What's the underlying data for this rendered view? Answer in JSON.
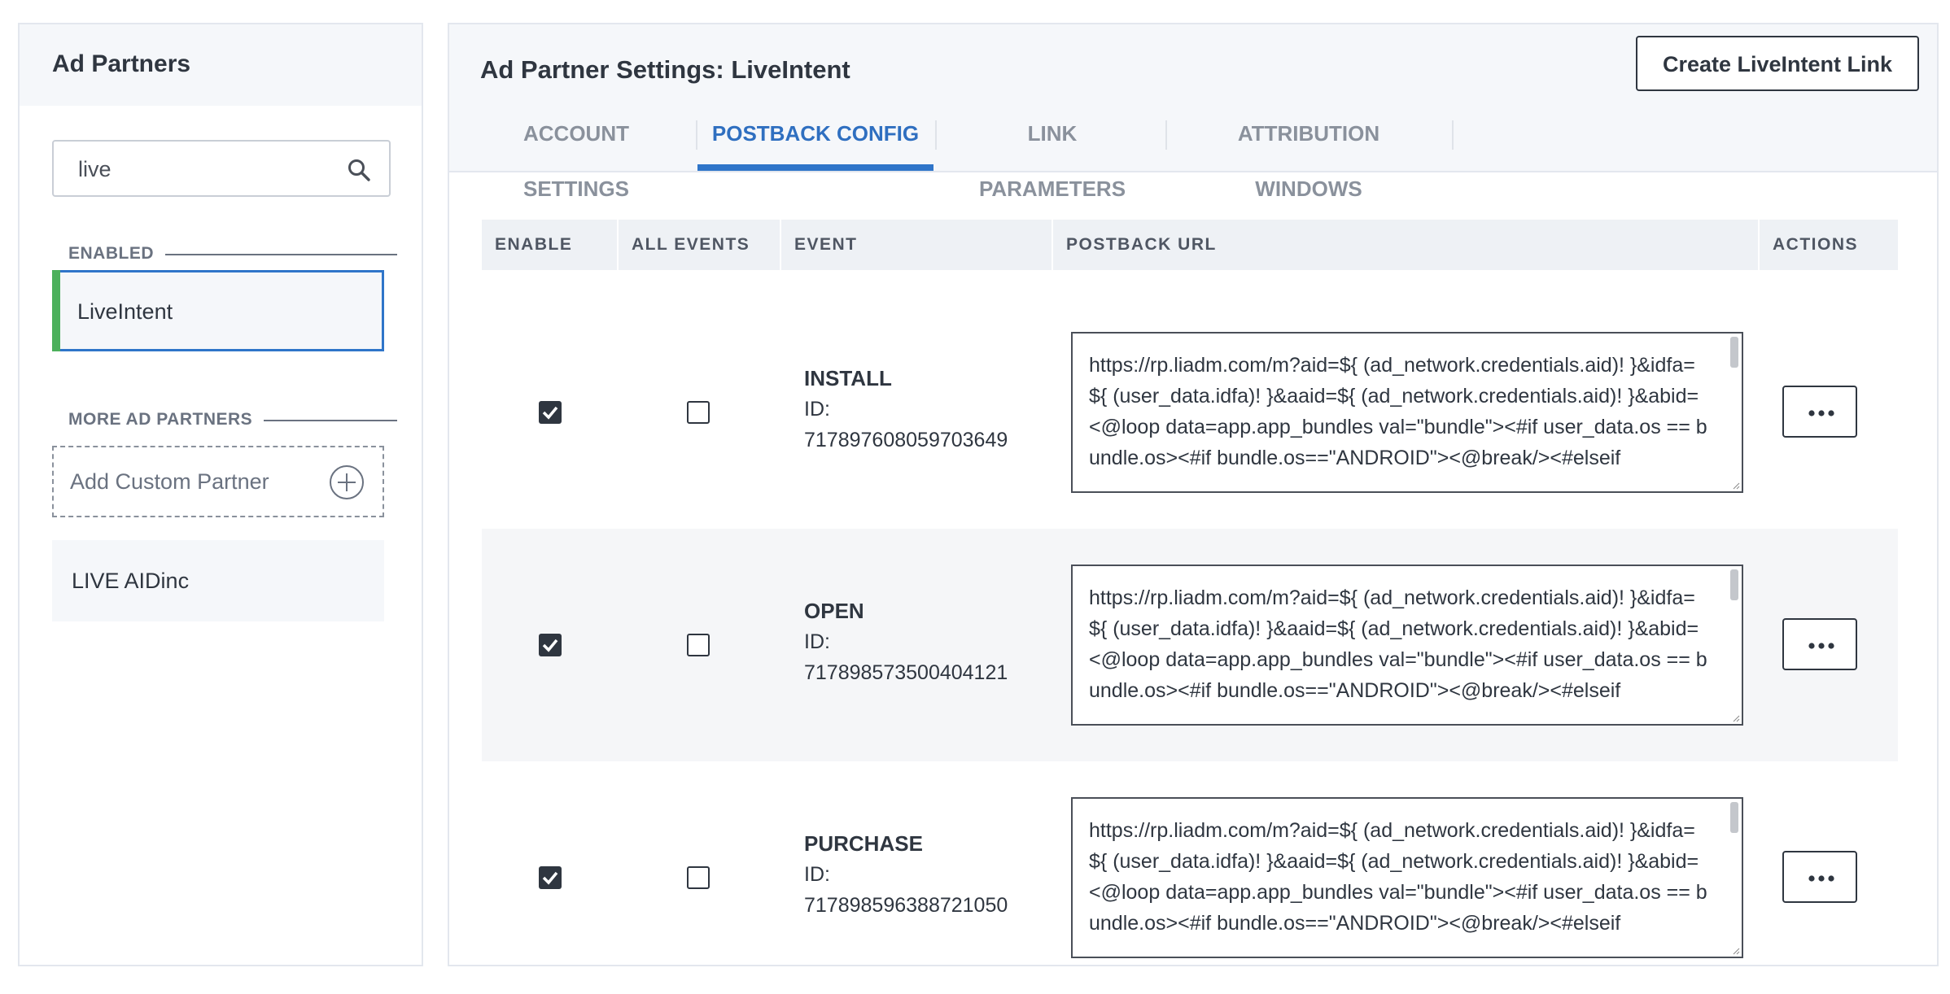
{
  "sidebar": {
    "title": "Ad Partners",
    "search": {
      "value": "live",
      "placeholder": ""
    },
    "enabled_label": "ENABLED",
    "enabled_items": [
      "LiveIntent"
    ],
    "more_label": "MORE AD PARTNERS",
    "add_custom_label": "Add Custom Partner",
    "more_items": [
      "LIVE AIDinc"
    ]
  },
  "main": {
    "title": "Ad Partner Settings: LiveIntent",
    "create_button": "Create LiveIntent Link",
    "tabs": [
      {
        "label": "ACCOUNT SETTINGS",
        "active": false
      },
      {
        "label": "POSTBACK CONFIG",
        "active": true
      },
      {
        "label": "LINK PARAMETERS",
        "active": false
      },
      {
        "label": "ATTRIBUTION WINDOWS",
        "active": false
      }
    ],
    "table": {
      "headers": [
        "ENABLE",
        "ALL EVENTS",
        "EVENT",
        "POSTBACK URL",
        "ACTIONS"
      ],
      "rows": [
        {
          "enable": true,
          "all_events": false,
          "event": "INSTALL",
          "id_label": "ID:",
          "id": "717897608059703649",
          "url": "https://rp.liadm.com/m?aid=${ (ad_network.credentials.aid)! }&idfa=${ (user_data.idfa)! }&aaid=${ (ad_network.credentials.aid)! }&abid=<@loop data=app.app_bundles val=\"bundle\"><#if user_data.os == bundle.os><#if bundle.os==\"ANDROID\"><@break/><#elseif"
        },
        {
          "enable": true,
          "all_events": false,
          "event": "OPEN",
          "id_label": "ID:",
          "id": "717898573500404121",
          "url": "https://rp.liadm.com/m?aid=${ (ad_network.credentials.aid)! }&idfa=${ (user_data.idfa)! }&aaid=${ (ad_network.credentials.aid)! }&abid=<@loop data=app.app_bundles val=\"bundle\"><#if user_data.os == bundle.os><#if bundle.os==\"ANDROID\"><@break/><#elseif"
        },
        {
          "enable": true,
          "all_events": false,
          "event": "PURCHASE",
          "id_label": "ID:",
          "id": "717898596388721050",
          "url": "https://rp.liadm.com/m?aid=${ (ad_network.credentials.aid)! }&idfa=${ (user_data.idfa)! }&aaid=${ (ad_network.credentials.aid)! }&abid=<@loop data=app.app_bundles val=\"bundle\"><#if user_data.os == bundle.os><#if bundle.os==\"ANDROID\"><@break/><#elseif"
        }
      ]
    },
    "actions_icon": "ellipsis-icon"
  }
}
